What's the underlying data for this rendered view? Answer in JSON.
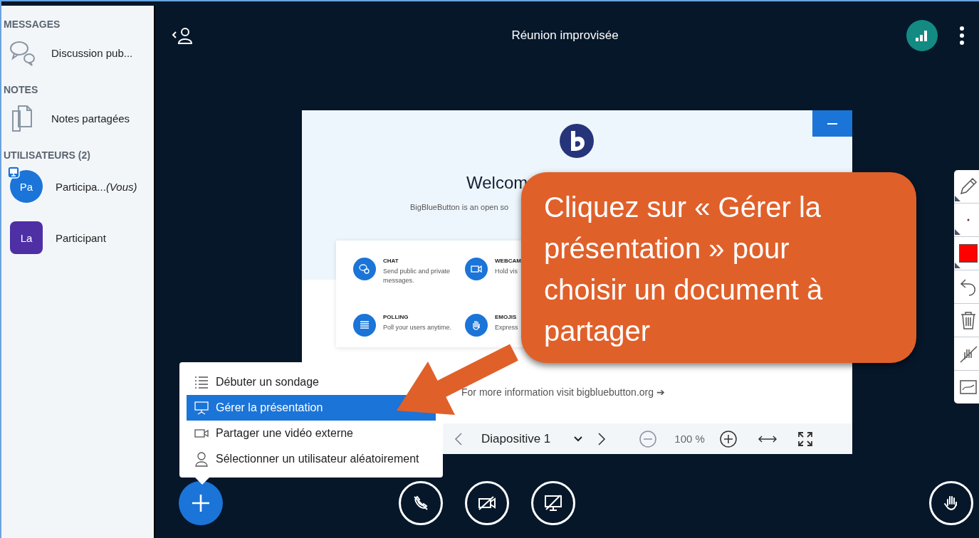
{
  "sidebar": {
    "sections": [
      {
        "heading": "MESSAGES",
        "items": [
          {
            "kind": "chat",
            "label": "Discussion pub..."
          }
        ]
      },
      {
        "heading": "NOTES",
        "items": [
          {
            "kind": "notes",
            "label": "Notes partagées"
          }
        ]
      },
      {
        "heading": "UTILISATEURS (2)",
        "users": [
          {
            "initials": "Pa",
            "name": "Participa...",
            "you": "(Vous)",
            "kind": "round",
            "presenter": true,
            "color": "#1b74d8"
          },
          {
            "initials": "La",
            "name": "Participant",
            "kind": "square",
            "presenter": false,
            "color": "#4e2fa4"
          }
        ]
      }
    ]
  },
  "header": {
    "title": "Réunion improvisée"
  },
  "slide": {
    "title": "Welcom",
    "subtitle": "BigBlueButton is an open so",
    "features": [
      {
        "kind": "chat",
        "title": "CHAT",
        "text": "Send public and private messages."
      },
      {
        "kind": "webcam",
        "title": "WEBCAM",
        "text": "Hold vis"
      },
      {
        "kind": "polling",
        "title": "POLLING",
        "text": "Poll your users anytime."
      },
      {
        "kind": "emojis",
        "title": "EMOJIS",
        "text": "Express"
      }
    ],
    "footer": "For more information visit bigbluebutton.org ➔",
    "nav": {
      "page": "Diapositive 1",
      "zoom": "100 %"
    }
  },
  "tools": [
    {
      "kind": "pencil"
    },
    {
      "kind": "thickness"
    },
    {
      "kind": "color",
      "color": "#ff0000"
    },
    {
      "kind": "undo"
    },
    {
      "kind": "trash"
    },
    {
      "kind": "multiuser"
    },
    {
      "kind": "whiteboard"
    }
  ],
  "actions_menu": {
    "items": [
      {
        "kind": "poll",
        "label": "Débuter un sondage",
        "selected": false
      },
      {
        "kind": "presentation",
        "label": "Gérer la présentation",
        "selected": true
      },
      {
        "kind": "video",
        "label": "Partager une vidéo externe",
        "selected": false
      },
      {
        "kind": "user",
        "label": "Sélectionner un utilisateur aléatoirement",
        "selected": false
      }
    ]
  },
  "media_buttons": [
    {
      "kind": "audio"
    },
    {
      "kind": "camera"
    },
    {
      "kind": "screen"
    }
  ],
  "callout": {
    "text": "Cliquez sur « Gérer la présentation » pour choisir un document à partager"
  }
}
